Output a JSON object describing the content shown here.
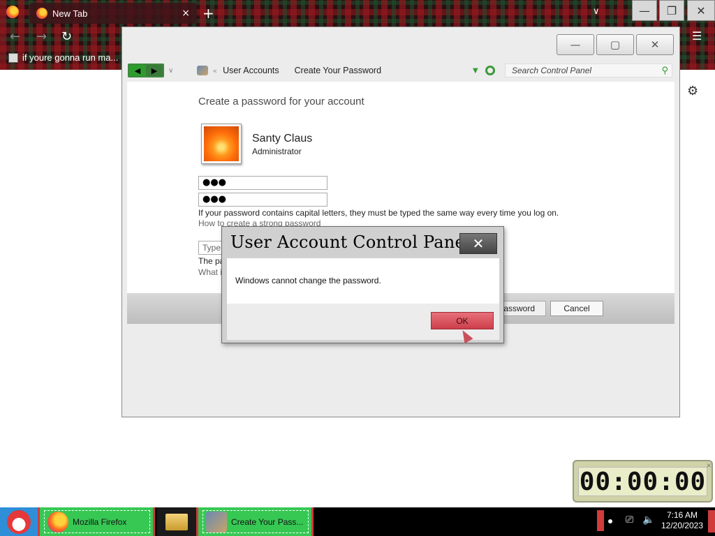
{
  "browser": {
    "tab_title": "New Tab",
    "tab_close": "×",
    "new_tab": "+",
    "list_all_tabs": "∨",
    "bookmark_label": "if youre gonna run ma...",
    "back": "←",
    "forward": "→",
    "reload": "↻",
    "menu": "☰",
    "settings": "⚙",
    "window_buttons": {
      "minimize": "—",
      "restore": "❐",
      "close": "✕"
    }
  },
  "control_panel": {
    "window_buttons": {
      "minimize": "—",
      "maximize": "▢",
      "close": "✕"
    },
    "nav": {
      "back": "◀",
      "forward": "▶",
      "recent": "∨"
    },
    "breadcrumb_sep": "«",
    "breadcrumb": [
      "User Accounts",
      "Create Your Password"
    ],
    "search_placeholder": "Search Control Panel",
    "search_icon": "search-icon",
    "heading": "Create a password for your account",
    "user": {
      "name": "Santy Claus",
      "role": "Administrator"
    },
    "new_password_value": "●●●",
    "confirm_password_value": "●●●",
    "capital_note": "If your password contains capital letters, they must be typed the same way every time you log on.",
    "strong_link": "How to create a strong password",
    "hint_placeholder": "Type",
    "hint_note": "The pa",
    "hint_link": "What i",
    "create_button": "assword",
    "cancel_button": "Cancel"
  },
  "dialog": {
    "title": "User Account Control Panel",
    "close": "✕",
    "message": "Windows cannot change the password.",
    "ok_button": "OK"
  },
  "timer": {
    "display": "00:00:00",
    "close": "×"
  },
  "taskbar": {
    "firefox_label": "Mozilla Firefox",
    "control_panel_label": "Create Your Pass...",
    "time": "7:16 AM",
    "date": "12/20/2023",
    "network_icon": "⎚",
    "volume_icon": "🔈"
  }
}
